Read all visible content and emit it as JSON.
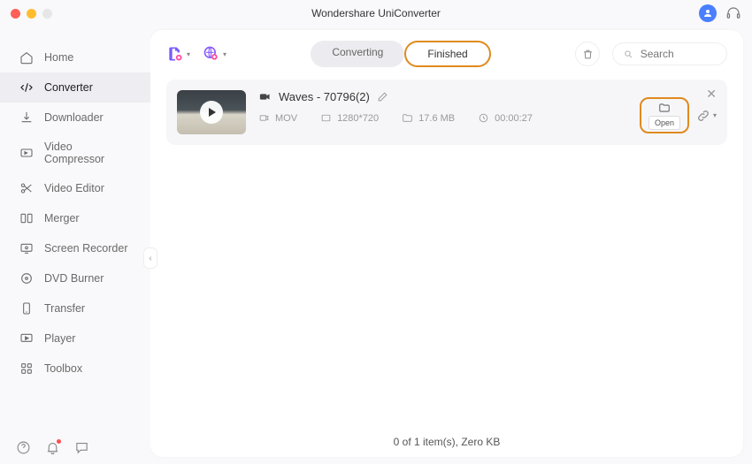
{
  "titlebar": {
    "title": "Wondershare UniConverter"
  },
  "sidebar": {
    "items": [
      {
        "label": "Home"
      },
      {
        "label": "Converter"
      },
      {
        "label": "Downloader"
      },
      {
        "label": "Video Compressor"
      },
      {
        "label": "Video Editor"
      },
      {
        "label": "Merger"
      },
      {
        "label": "Screen Recorder"
      },
      {
        "label": "DVD Burner"
      },
      {
        "label": "Transfer"
      },
      {
        "label": "Player"
      },
      {
        "label": "Toolbox"
      }
    ]
  },
  "segments": {
    "converting": "Converting",
    "finished": "Finished"
  },
  "search": {
    "placeholder": "Search"
  },
  "file": {
    "title": "Waves - 70796(2)",
    "format": "MOV",
    "resolution": "1280*720",
    "size": "17.6 MB",
    "duration": "00:00:27",
    "open_label": "Open"
  },
  "status": "0 of 1 item(s), Zero KB",
  "highlight_color": "#e08a1f"
}
